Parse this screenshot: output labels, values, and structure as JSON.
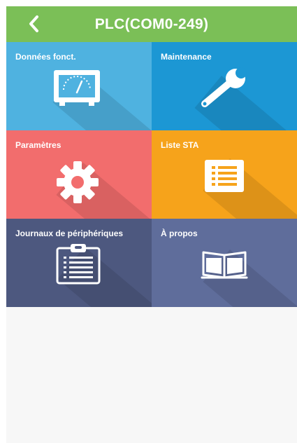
{
  "header": {
    "title": "PLC(COM0-249)",
    "back_icon": "chevron-left-icon",
    "background": "#7bbf57"
  },
  "tiles": [
    {
      "label": "Données fonct.",
      "icon": "meter-gauge-icon",
      "color": "#4fb2e0"
    },
    {
      "label": "Maintenance",
      "icon": "wrench-icon",
      "color": "#1c97d4"
    },
    {
      "label": "Paramètres",
      "icon": "gear-icon",
      "color": "#f26d6d"
    },
    {
      "label": "Liste STA",
      "icon": "list-icon",
      "color": "#f6a31b"
    },
    {
      "label": "Journaux de périphériques",
      "icon": "clipboard-icon",
      "color": "#4d587f"
    },
    {
      "label": "À propos",
      "icon": "book-icon",
      "color": "#5f6d9b"
    }
  ]
}
